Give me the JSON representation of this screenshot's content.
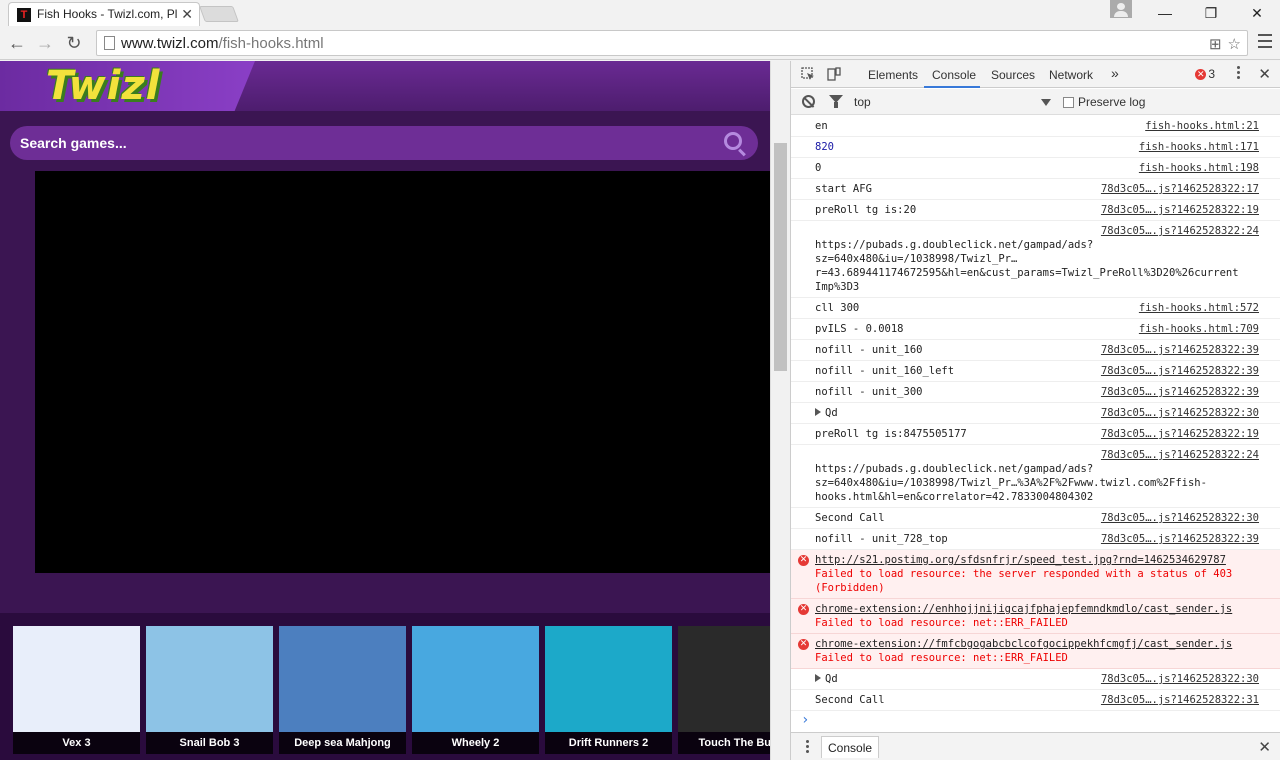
{
  "browser": {
    "tab_title": "Fish Hooks - Twizl.com, Pl",
    "favicon_letter": "T",
    "url_host": "www.twizl.com",
    "url_path": "/fish-hooks.html"
  },
  "site": {
    "logo_text": "Twizl",
    "search_placeholder": "Search games...",
    "games": [
      {
        "title": "Vex 3",
        "color": "#e8eefa"
      },
      {
        "title": "Snail Bob 3",
        "color": "#8dc3e6"
      },
      {
        "title": "Deep sea Mahjong",
        "color": "#4c7fbf"
      },
      {
        "title": "Wheely 2",
        "color": "#48a8e0"
      },
      {
        "title": "Drift Runners 2",
        "color": "#1ca9c9"
      },
      {
        "title": "Touch The Bubb",
        "color": "#2a2a2a"
      }
    ]
  },
  "devtools": {
    "tabs": [
      "Elements",
      "Console",
      "Sources",
      "Network"
    ],
    "more": "»",
    "error_count": "3",
    "context": "top",
    "preserve_log": "Preserve log",
    "drawer_tab": "Console",
    "console": [
      {
        "msg": "en",
        "src": "fish-hooks.html:21"
      },
      {
        "msg": "820",
        "src": "fish-hooks.html:171",
        "blue": true
      },
      {
        "msg": "0",
        "src": "fish-hooks.html:198"
      },
      {
        "msg": "start AFG",
        "src": "78d3c05….js?1462528322:17"
      },
      {
        "msg": "preRoll tg is:20",
        "src": "78d3c05….js?1462528322:19"
      },
      {
        "msg": "https://pubads.g.doubleclick.net/gampad/ads?\nsz=640x480&iu=/1038998/Twizl_Pr…\nr=43.689441174672595&hl=en&cust_params=Twizl_PreRoll%3D20%26current\nImp%3D3",
        "src": "78d3c05….js?1462528322:24",
        "src_top": true
      },
      {
        "msg": "cll 300",
        "src": "fish-hooks.html:572"
      },
      {
        "msg": "pvILS - 0.0018",
        "src": "fish-hooks.html:709"
      },
      {
        "msg": "nofill - unit_160",
        "src": "78d3c05….js?1462528322:39"
      },
      {
        "msg": "nofill - unit_160_left",
        "src": "78d3c05….js?1462528322:39"
      },
      {
        "msg": "nofill - unit_300",
        "src": "78d3c05….js?1462528322:39"
      },
      {
        "msg": "Qd",
        "src": "78d3c05….js?1462528322:30",
        "expand": true
      },
      {
        "msg": "preRoll tg is:8475505177",
        "src": "78d3c05….js?1462528322:19"
      },
      {
        "msg": "https://pubads.g.doubleclick.net/gampad/ads?\nsz=640x480&iu=/1038998/Twizl_Pr…%3A%2F%2Fwww.twizl.com%2Ffish-\nhooks.html&hl=en&correlator=42.7833004804302",
        "src": "78d3c05….js?1462528322:24",
        "src_top": true
      },
      {
        "msg": "Second Call",
        "src": "78d3c05….js?1462528322:30"
      },
      {
        "msg": "nofill - unit_728_top",
        "src": "78d3c05….js?1462528322:39"
      },
      {
        "err": true,
        "src": "http://s21.postimg.org/sfdsnfrjr/speed_test.jpg?rnd=1462534629787",
        "msg": "Failed to load resource: the server responded with a status of 403\n(Forbidden)"
      },
      {
        "err": true,
        "src": "chrome-extension://enhhojjnijigcajfphajepfemndkmdlo/cast_sender.js",
        "msg": "Failed to load resource: net::ERR_FAILED"
      },
      {
        "err": true,
        "src": "chrome-extension://fmfcbgogabcbclcofgocippekhfcmgfj/cast_sender.js",
        "msg": "Failed to load resource: net::ERR_FAILED"
      },
      {
        "msg": "Qd",
        "src": "78d3c05….js?1462528322:30",
        "expand": true
      },
      {
        "msg": "Second Call",
        "src": "78d3c05….js?1462528322:31"
      }
    ]
  }
}
